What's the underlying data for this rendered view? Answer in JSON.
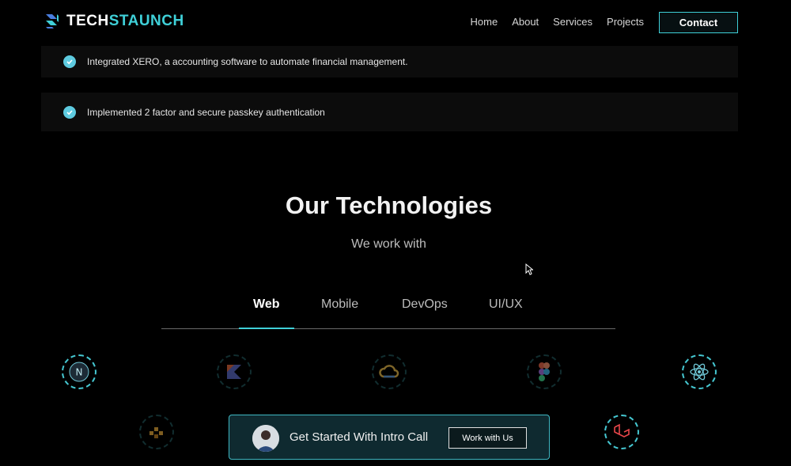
{
  "brand": {
    "name_part1": "TECH",
    "name_part2": "STAUNCH"
  },
  "nav": {
    "items": [
      "Home",
      "About",
      "Services",
      "Projects"
    ],
    "contact_label": "Contact"
  },
  "features": [
    "Integrated XERO, a accounting software to automate financial management.",
    "Implemented 2 factor and secure passkey authentication"
  ],
  "technologies": {
    "title": "Our Technologies",
    "subtitle": "We work with",
    "tabs": [
      "Web",
      "Mobile",
      "DevOps",
      "UI/UX"
    ],
    "active_tab": "Web",
    "icons": [
      "nextjs-icon",
      "kotlin-icon",
      "google-cloud-icon",
      "figma-icon",
      "react-icon",
      "aws-icon",
      "laravel-icon"
    ]
  },
  "cta": {
    "text": "Get Started With Intro Call",
    "button_label": "Work with Us"
  },
  "colors": {
    "accent": "#3fd0d8",
    "background": "#000000",
    "panel": "#0c0c0c"
  }
}
